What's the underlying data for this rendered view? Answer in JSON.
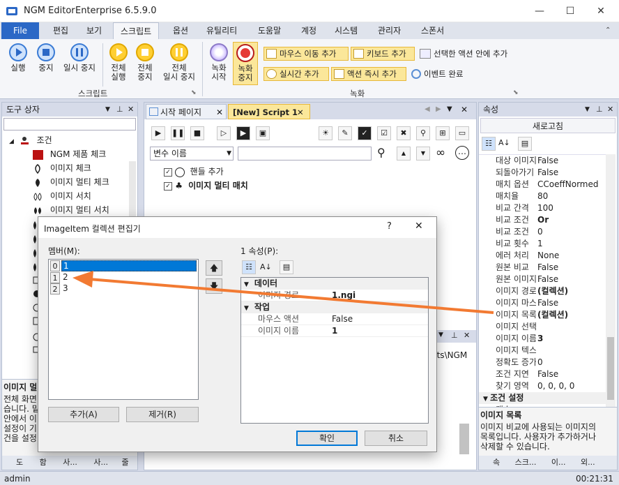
{
  "window": {
    "title": "NGM Editor",
    "version": "Enterprise 6.5.9.0",
    "controls": [
      "—",
      "☐",
      "✕"
    ]
  },
  "menu": {
    "file": "File",
    "tabs": [
      "편집",
      "보기",
      "스크립트",
      "옵션",
      "유틸리티",
      "도움말",
      "계정",
      "시스템",
      "관리자",
      "스폰서"
    ],
    "active": "스크립트"
  },
  "ribbon": {
    "script_group": "스크립트",
    "record_group": "녹화",
    "buttons": {
      "run": "실행",
      "stop": "중지",
      "pause": "일시 중지",
      "run_all_1": "전체",
      "run_all_2": "실행",
      "stop_all_1": "전체",
      "stop_all_2": "중지",
      "pause_all_1": "전체",
      "pause_all_2": "일시 중지",
      "rec_start_1": "녹화",
      "rec_start_2": "시작",
      "rec_stop_1": "녹화",
      "rec_stop_2": "중지"
    },
    "small": {
      "mouse_move": "마우스 이동 추가",
      "keyboard": "키보드 추가",
      "in_action": "선택한 액션 안에 추가",
      "realtime": "실시간 추가",
      "instant": "액션 즉시 추가",
      "event_done": "이벤트 완료"
    }
  },
  "toolbox": {
    "title": "도구 상자",
    "search_placeholder": "",
    "root": "조건",
    "items": [
      "NGM 제품 체크",
      "이미지 체크",
      "이미지 멀티 체크",
      "이미지 서치",
      "이미지 멀티 서치"
    ],
    "desc_title": "이미지 멀",
    "desc_lines": [
      "전체 화면",
      "습니다. 밑",
      "안에서 이",
      "설정이 기",
      "건을 설정"
    ],
    "tabs": [
      "도",
      "함",
      "사...",
      "사...",
      "줄"
    ]
  },
  "editor": {
    "tabs": [
      "시작 페이지",
      "[New] Script 1"
    ],
    "active_tab": "[New] Script 1",
    "var_select": "변수 이름",
    "script_lines": [
      {
        "label": "핸들 추가",
        "bold": false
      },
      {
        "label": "이미지 멀티 매치",
        "bold": true
      }
    ],
    "hidden_path_text": "nts\\NGM"
  },
  "properties": {
    "title": "속성",
    "refresh": "새로고침",
    "rows": [
      {
        "name": "대상 이미지",
        "value": "False"
      },
      {
        "name": "되돌아가기",
        "value": "False"
      },
      {
        "name": "매치 옵션",
        "value": "CCoeffNormed"
      },
      {
        "name": "매치율",
        "value": "80"
      },
      {
        "name": "비교 간격",
        "value": "100"
      },
      {
        "name": "비교 조건",
        "value": "Or",
        "bold": true
      },
      {
        "name": "비교 조건",
        "value": "0"
      },
      {
        "name": "비교 횟수",
        "value": "1"
      },
      {
        "name": "에러 처리",
        "value": "None"
      },
      {
        "name": "원본 비교",
        "value": "False"
      },
      {
        "name": "원본 이미지",
        "value": "False"
      },
      {
        "name": "이미지 경로",
        "value": "(컬렉션)",
        "bold": true
      },
      {
        "name": "이미지 마스크",
        "value": "False"
      },
      {
        "name": "이미지 목록",
        "value": "(컬렉션)",
        "bold": true
      },
      {
        "name": "이미지 선택",
        "value": ""
      },
      {
        "name": "이미지 이름",
        "value": "3",
        "bold": true
      },
      {
        "name": "이미지 텍스트",
        "value": ""
      },
      {
        "name": "정확도 증가",
        "value": "0"
      },
      {
        "name": "조건 지연",
        "value": "False"
      },
      {
        "name": "찾기 영역",
        "value": "0, 0, 0, 0"
      }
    ],
    "section": "조건 설정",
    "cut_row": "갯수",
    "desc_title": "이미지 목록",
    "desc_lines": [
      "이미지 비교에 사용되는 이미지의",
      "목록입니다. 사용자가 추가하거나",
      "삭제할 수 있습니다."
    ],
    "tabs": [
      "속",
      "스크...",
      "이...",
      "외..."
    ]
  },
  "dialog": {
    "title": "ImageItem 컬렉션 편집기",
    "help": "?",
    "close": "✕",
    "members_label": "멤버(M):",
    "members": [
      {
        "index": "0",
        "name": "1"
      },
      {
        "index": "1",
        "name": "2"
      },
      {
        "index": "2",
        "name": "3"
      }
    ],
    "props_label": "1 속성(P):",
    "cat_data": "데이터",
    "cat_action": "작업",
    "props": [
      {
        "name": "이미지 경로",
        "value": "1.ngi",
        "cat": "data"
      },
      {
        "name": "마우스 액션",
        "value": "False",
        "cat": "action"
      },
      {
        "name": "이미지 이름",
        "value": "1",
        "cat": "action"
      }
    ],
    "add": "추가(A)",
    "remove": "제거(R)",
    "ok": "확인",
    "cancel": "취소"
  },
  "status": {
    "user": "admin",
    "time": "00:21:31"
  },
  "colors": {
    "accent": "#2b68c6",
    "arrow": "#f27a32",
    "highlight": "#0078d7",
    "record_red": "#e53935"
  }
}
